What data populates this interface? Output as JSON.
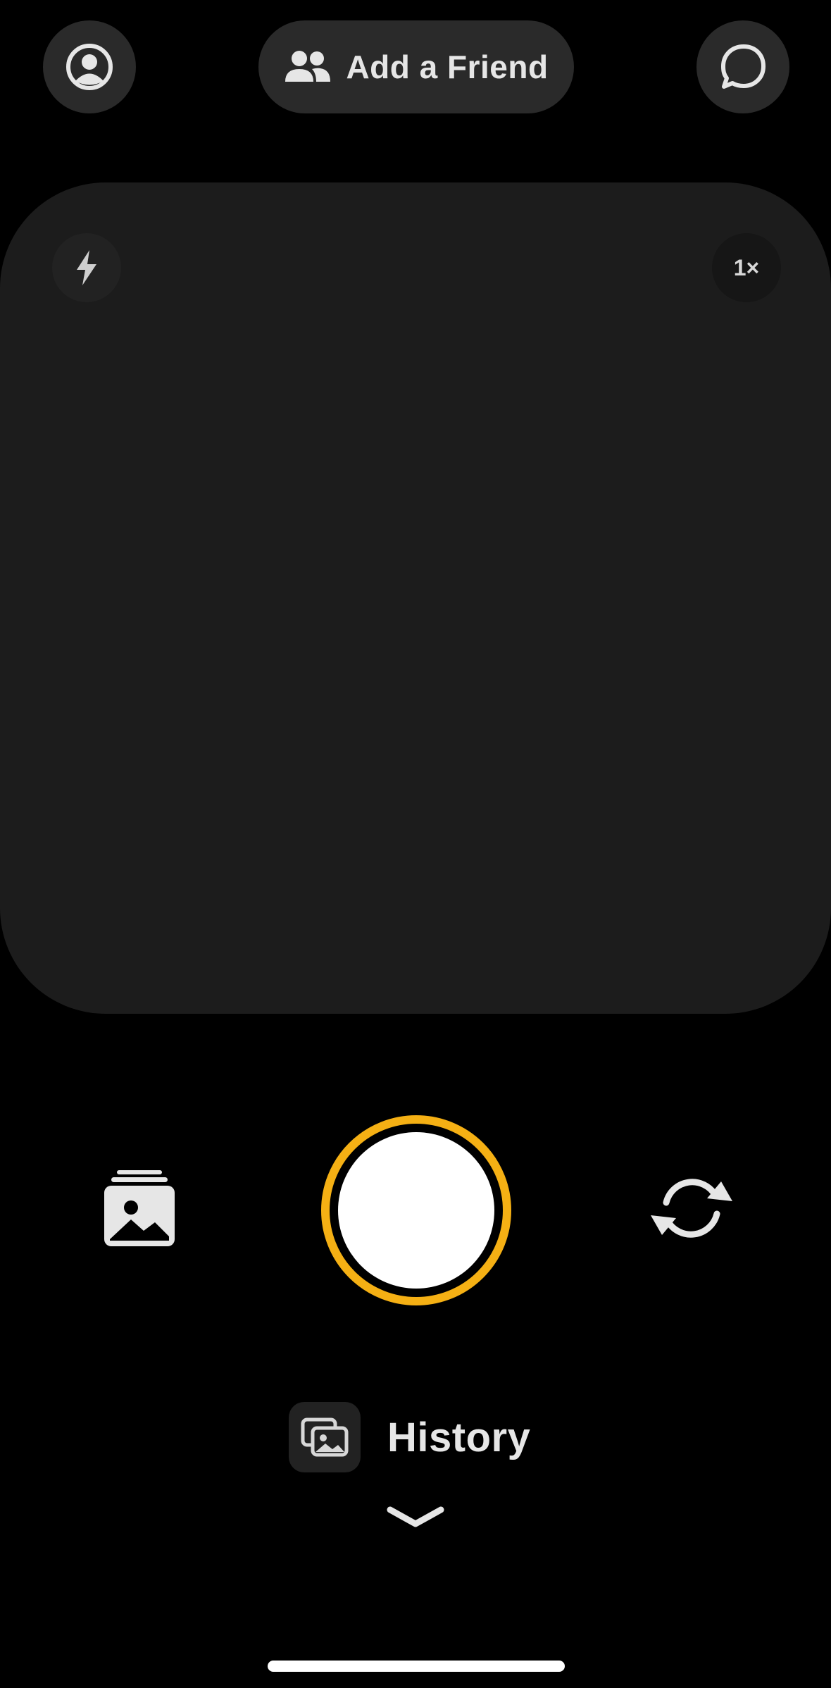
{
  "header": {
    "add_friend_label": "Add a Friend",
    "profile_icon": "profile-icon",
    "friends_icon": "friends-icon",
    "chat_icon": "chat-bubble-icon"
  },
  "camera": {
    "flash_icon": "flash-icon",
    "zoom_label": "1×"
  },
  "controls": {
    "gallery_icon": "gallery-icon",
    "shutter_ring_color": "#f5b014",
    "flip_icon": "flip-camera-icon"
  },
  "history": {
    "label": "History",
    "icon": "photos-icon",
    "expand_icon": "chevron-down-icon"
  },
  "colors": {
    "background": "#000000",
    "viewfinder": "#1c1c1c",
    "button_bg": "#2a2a2a",
    "accent": "#f5b014"
  }
}
